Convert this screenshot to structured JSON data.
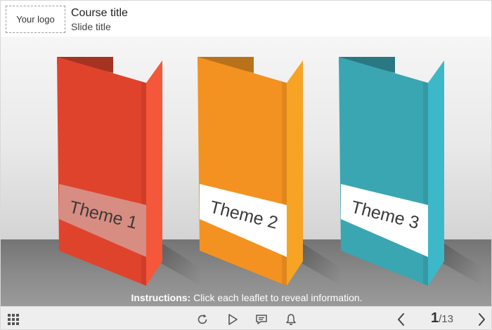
{
  "header": {
    "logo_label": "Your logo",
    "course_title": "Course title",
    "slide_title": "Slide title"
  },
  "leaflets": [
    {
      "label": "Theme 1",
      "front": "#e0432c",
      "side": "#f4573a",
      "inner": "#a53322",
      "band": "rgba(215,150,140,0.9)"
    },
    {
      "label": "Theme 2",
      "front": "#f39220",
      "side": "#f7a324",
      "inner": "#b9721b",
      "band": "#ffffff"
    },
    {
      "label": "Theme 3",
      "front": "#3aa6b2",
      "side": "#3db8c8",
      "inner": "#2a7882",
      "band": "#ffffff"
    }
  ],
  "instructions": {
    "prefix": "Instructions:",
    "text": " Click each leaflet to reveal information."
  },
  "footer": {
    "menu_icon": "grid-menu-icon",
    "replay_icon": "replay-icon",
    "play_icon": "play-icon",
    "notes_icon": "notes-icon",
    "notifications_icon": "bell-icon",
    "prev_icon": "chevron-left-icon",
    "next_icon": "chevron-right-icon",
    "current_page": "1",
    "page_separator": "/",
    "total_pages": "13"
  }
}
